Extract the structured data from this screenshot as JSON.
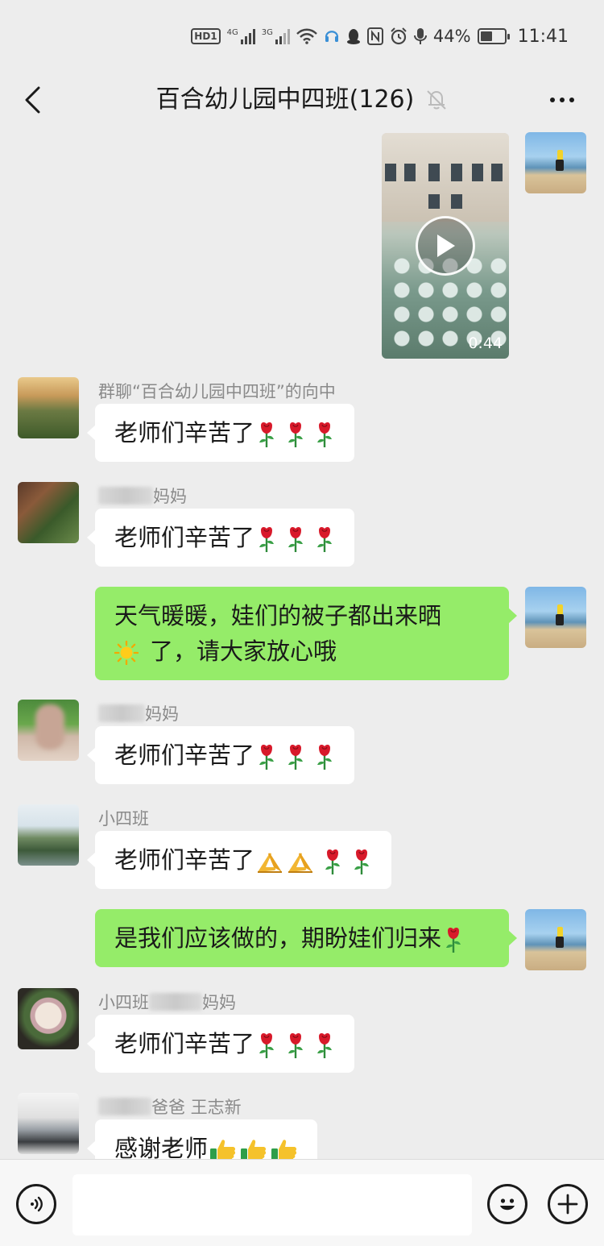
{
  "status_bar": {
    "network_left": "4G",
    "network_right": "3G",
    "battery_text": "44%",
    "battery_level": 0.44,
    "time": "11:41"
  },
  "header": {
    "title": "百合幼儿园中四班(126)"
  },
  "chat": {
    "video": {
      "duration": "0:44"
    },
    "messages": [
      {
        "sender": "群聊“百合幼儿园中四班”的向中",
        "text": "老师们辛苦了"
      },
      {
        "sender_visible": "妈妈",
        "text": "老师们辛苦了"
      },
      {
        "text_line1": "天气暖暖，娃们的被子都出来晒",
        "text_line2": "了，请大家放心哦"
      },
      {
        "sender_visible": "妈妈",
        "text": "老师们辛苦了"
      },
      {
        "sender": "小四班",
        "text": "老师们辛苦了"
      },
      {
        "text": "是我们应该做的，期盼娃们归来"
      },
      {
        "sender_prefix": "小四班",
        "sender_suffix": "妈妈",
        "text": "老师们辛苦了"
      },
      {
        "sender_middle": "爸爸 王志新",
        "text": "感谢老师"
      }
    ]
  },
  "input_bar": {
    "placeholder": ""
  },
  "icons": {
    "back": "chevron-left-icon",
    "mute": "bell-off-icon",
    "more": "more-horizontal-icon",
    "voice": "voice-icon",
    "emoji": "emoji-icon",
    "plus": "plus-icon",
    "rose": "rose-emoji",
    "pray": "pray-emoji",
    "thumbs": "thumbs-up-emoji",
    "sun": "sun-emoji"
  },
  "colors": {
    "background": "#ededed",
    "own_bubble": "#95ec69",
    "other_bubble": "#ffffff"
  }
}
